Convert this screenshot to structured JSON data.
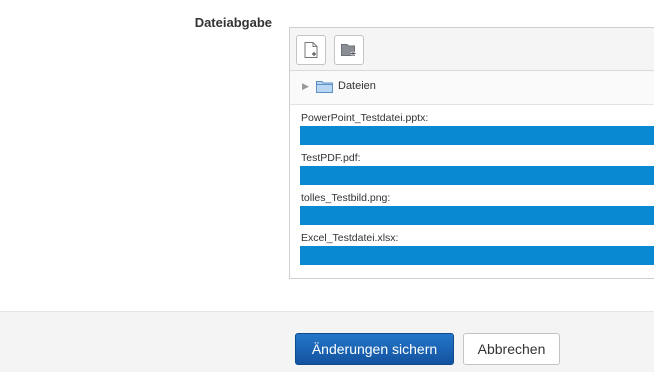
{
  "field": {
    "label": "Dateiabgabe"
  },
  "toolbar": {
    "buttons": [
      {
        "icon": "add-file-icon"
      },
      {
        "icon": "create-folder-icon"
      }
    ]
  },
  "path": {
    "folder_icon": "folder-icon",
    "label": "Dateien"
  },
  "files": [
    {
      "name": "PowerPoint_Testdatei.pptx:"
    },
    {
      "name": "TestPDF.pdf:"
    },
    {
      "name": "tolles_Testbild.png:"
    },
    {
      "name": "Excel_Testdatei.xlsx:"
    }
  ],
  "footer": {
    "save_label": "Änderungen sichern",
    "cancel_label": "Abbrechen"
  },
  "colors": {
    "progress_bar": "#0a89d3",
    "primary_button": "#1a62b5"
  }
}
